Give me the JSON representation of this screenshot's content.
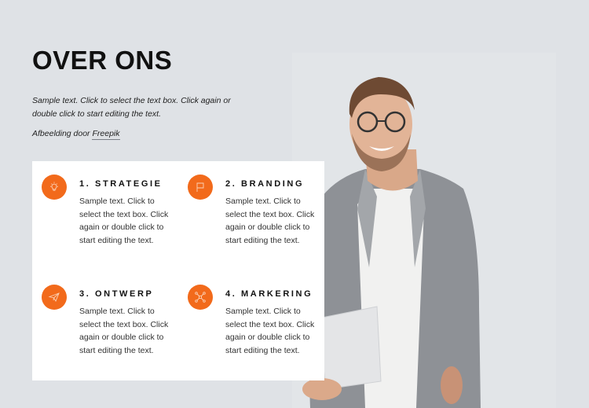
{
  "page": {
    "title": "OVER ONS",
    "intro": "Sample text. Click to select the text box. Click again or double click to start editing the text.",
    "credit_prefix": "Afbeelding door ",
    "credit_link": "Freepik"
  },
  "colors": {
    "accent": "#f26a1b",
    "background": "#dfe2e6",
    "card": "#ffffff"
  },
  "features": [
    {
      "title": "1. STRATEGIE",
      "text": "Sample text. Click to select the text box. Click again or double click to start editing the text.",
      "icon": "lightbulb-icon"
    },
    {
      "title": "2. BRANDING",
      "text": "Sample text. Click to select the text box. Click again or double click to start editing the text.",
      "icon": "flag-icon"
    },
    {
      "title": "3. ONTWERP",
      "text": "Sample text. Click to select the text box. Click again or double click to start editing the text.",
      "icon": "paper-plane-icon"
    },
    {
      "title": "4. MARKERING",
      "text": "Sample text. Click to select the text box. Click again or double click to start editing the text.",
      "icon": "network-icon"
    }
  ],
  "image": {
    "description": "smiling man with glasses in grey blazer holding a laptop"
  }
}
